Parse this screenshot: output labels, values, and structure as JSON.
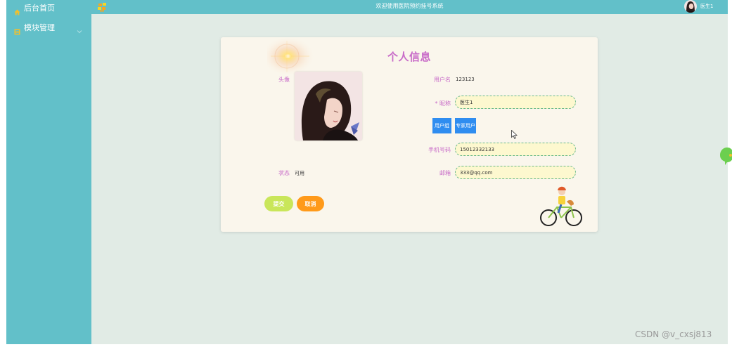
{
  "sidebar": {
    "items": [
      {
        "label": "后台首页",
        "icon": "home-icon"
      },
      {
        "label": "模块管理",
        "icon": "module-icon",
        "expand_icon": "chevron-down-icon"
      }
    ]
  },
  "header": {
    "title": "欢迎使用医院预约挂号系统",
    "username": "医生1",
    "logo_icon": "app-logo-icon",
    "avatar_icon": "user-avatar"
  },
  "form": {
    "title": "个人信息",
    "avatar_label": "头像",
    "username_label": "用户名",
    "username_value": "123123",
    "nickname_label": "* 昵称",
    "nickname_value": "医生1",
    "group_active": "用户组",
    "group_option": "专家用户",
    "phone_label": "手机号码",
    "phone_value": "15012332133",
    "email_label": "邮箱",
    "email_value": "333@qq.com",
    "status_label": "状态",
    "status_value": "可用",
    "submit_label": "提交",
    "cancel_label": "取消"
  },
  "decorations": {
    "sun": "sun-decoration",
    "bike": "cyclist-decoration",
    "chat": "chat-bubble-icon"
  },
  "watermark": "CSDN @v_cxsj813",
  "colors": {
    "sidebar": "#62c0c9",
    "main_bg": "#e1ebe5",
    "card_bg": "#faf6ec",
    "accent_label": "#c86bc8",
    "input_bg": "#fdf8cf",
    "input_border": "#66b88a",
    "group_button": "#2f8df0",
    "submit_button": "#c9e65a",
    "cancel_button": "#ff9a1a"
  }
}
